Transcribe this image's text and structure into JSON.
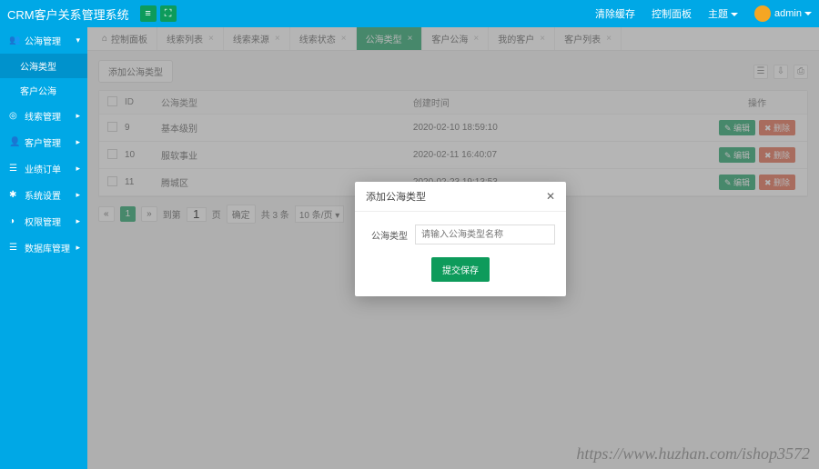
{
  "header": {
    "brand": "CRM客户关系管理系统",
    "links": {
      "clear_cache": "清除缓存",
      "control_panel": "控制面板",
      "theme": "主题"
    },
    "user": "admin"
  },
  "sidebar": {
    "items": [
      {
        "label": "公海管理",
        "expanded": true,
        "subs": [
          "公海类型",
          "客户公海"
        ],
        "active_sub": 0
      },
      {
        "label": "线索管理"
      },
      {
        "label": "客户管理"
      },
      {
        "label": "业绩订单"
      },
      {
        "label": "系统设置"
      },
      {
        "label": "权限管理"
      },
      {
        "label": "数据库管理"
      }
    ]
  },
  "tabs": [
    {
      "label": "控制面板",
      "icon": "home"
    },
    {
      "label": "线索列表",
      "closable": true
    },
    {
      "label": "线索来源",
      "closable": true
    },
    {
      "label": "线索状态",
      "closable": true
    },
    {
      "label": "公海类型",
      "closable": true,
      "active": true
    },
    {
      "label": "客户公海",
      "closable": true
    },
    {
      "label": "我的客户",
      "closable": true
    },
    {
      "label": "客户列表",
      "closable": true
    }
  ],
  "toolbar": {
    "add_btn": "添加公海类型"
  },
  "table": {
    "headers": {
      "id": "ID",
      "name": "公海类型",
      "time": "创建时间",
      "ops": "操作"
    },
    "ops": {
      "edit": "✎ 编辑",
      "del": "✖ 删除"
    },
    "rows": [
      {
        "id": "9",
        "name": "基本级别",
        "time": "2020-02-10 18:59:10"
      },
      {
        "id": "10",
        "name": "服软事业",
        "time": "2020-02-11 16:40:07"
      },
      {
        "id": "11",
        "name": "腾城区",
        "time": "2020-02-23 19:13:53"
      }
    ]
  },
  "pager": {
    "prev": "«",
    "cur": "1",
    "next": "»",
    "goto_pre": "到第",
    "goto_input": "1",
    "goto_suf": "页",
    "confirm": "确定",
    "total": "共 3 条",
    "size": "10 条/页 ▾"
  },
  "modal": {
    "title": "添加公海类型",
    "field_label": "公海类型",
    "placeholder": "请输入公海类型名称",
    "submit": "提交保存"
  },
  "watermark": "https://www.huzhan.com/ishop3572"
}
